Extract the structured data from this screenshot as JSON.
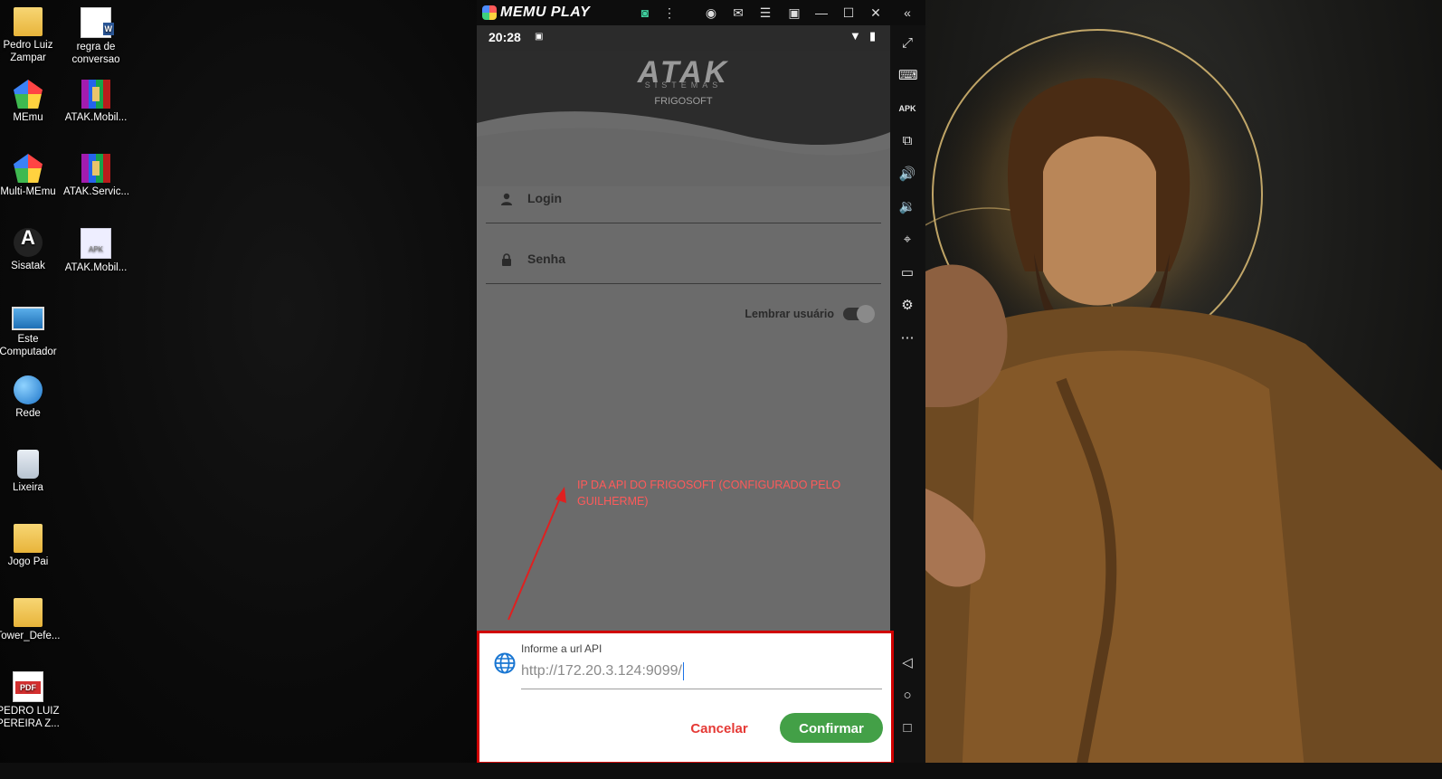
{
  "desktop_icons": [
    {
      "label": "Pedro Luiz Zampar",
      "icon": "user-folder-icon"
    },
    {
      "label": "regra de conversao",
      "icon": "word-document-icon"
    },
    {
      "label": "MEmu",
      "icon": "memu-app-icon"
    },
    {
      "label": "ATAK.Mobil...",
      "icon": "winrar-archive-icon"
    },
    {
      "label": "Multi-MEmu",
      "icon": "multi-memu-app-icon"
    },
    {
      "label": "ATAK.Servic...",
      "icon": "winrar-archive-icon"
    },
    {
      "label": "Sisatak",
      "icon": "sisatak-app-icon"
    },
    {
      "label": "ATAK.Mobil...",
      "icon": "apk-file-icon"
    },
    {
      "label": "Este Computador",
      "icon": "computer-icon"
    },
    {
      "label": "Rede",
      "icon": "network-globe-icon"
    },
    {
      "label": "Lixeira",
      "icon": "recycle-bin-icon"
    },
    {
      "label": "Jogo Pai",
      "icon": "folder-icon"
    },
    {
      "label": "Tower_Defe...",
      "icon": "folder-icon"
    },
    {
      "label": "PEDRO LUIZ PEREIRA Z...",
      "icon": "pdf-file-icon"
    }
  ],
  "emulator": {
    "brand": "MEMU PLAY",
    "top_icons": [
      "game-center-icon",
      "more-vertical-icon",
      "account-icon",
      "mail-icon",
      "menu-icon",
      "screen-record-icon",
      "minimize-icon",
      "maximize-icon",
      "close-icon",
      "collapse-sidebar-icon"
    ],
    "side_icons": [
      "fullscreen-icon",
      "keyboard-mapping-icon",
      "apk-install-icon",
      "multi-instance-icon",
      "volume-up-icon",
      "volume-down-icon",
      "location-icon",
      "shared-folder-icon",
      "settings-icon",
      "more-icon",
      "back-nav-icon",
      "home-nav-icon",
      "recent-apps-icon"
    ]
  },
  "status_bar": {
    "time": "20:28"
  },
  "app": {
    "logo": "ATAK",
    "logo_sub": "SISTEMAS",
    "product": "FRIGOSOFT",
    "login_label": "Login",
    "password_label": "Senha",
    "remember_label": "Lembrar usuário",
    "remember_on": true
  },
  "dialog": {
    "label": "Informe a url API",
    "value": "http://172.20.3.124:9099/",
    "cancel": "Cancelar",
    "confirm": "Confirmar"
  },
  "annotation": {
    "text": "IP DA API DO FRIGOSOFT (CONFIGURADO PELO GUILHERME)",
    "color": "#ff5a5a"
  },
  "colors": {
    "accent_green": "#43a047",
    "cancel_red": "#e53935",
    "highlight_border": "#d00000"
  }
}
